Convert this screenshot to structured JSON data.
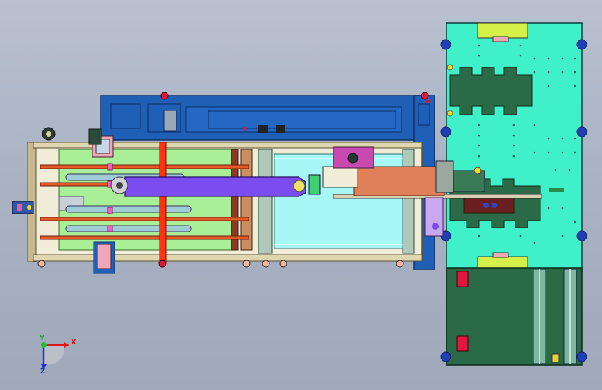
{
  "view": {
    "type": "cad-assembly-top-view",
    "background": "#a9b3c4"
  },
  "colors": {
    "frame_blue": "#1f5fb5",
    "frame_dark": "#0b2e66",
    "table_cyan": "#3ff0c8",
    "belt_cyan": "#a7f7f7",
    "tray_green": "#a8ef98",
    "arm_purple": "#7b4cf0",
    "bar_red": "#ff3311",
    "slide_orange": "#e0805a",
    "bracket_pink": "#f0a8b8",
    "dark_green": "#2a6a46",
    "lime": "#d6f04a",
    "base_plate": "#f2edd8"
  },
  "axes": {
    "x_label": "X",
    "y_label": "Y",
    "z_label": "Z"
  }
}
